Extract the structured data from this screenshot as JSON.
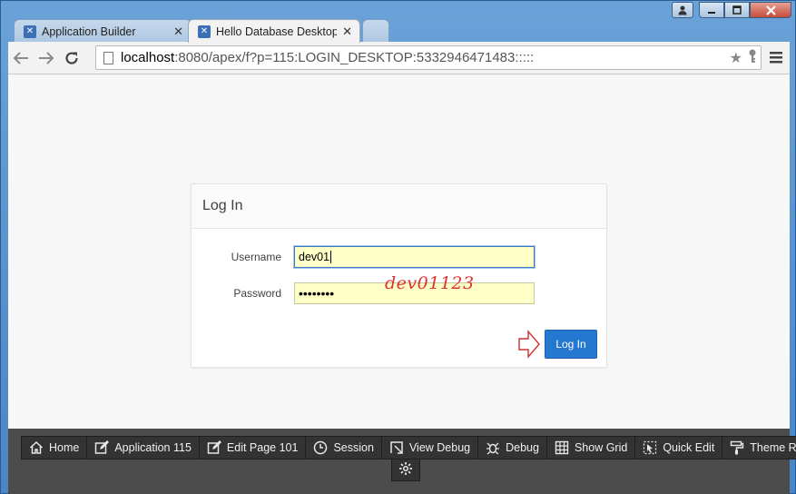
{
  "browser": {
    "tabs": [
      {
        "label": "Application Builder",
        "active": false
      },
      {
        "label": "Hello Database Desktop A",
        "active": true
      }
    ],
    "url_host": "localhost",
    "url_rest": ":8080/apex/f?p=115:LOGIN_DESKTOP:5332946471483:::::"
  },
  "login": {
    "title": "Log In",
    "username_label": "Username",
    "username_value": "dev01",
    "password_label": "Password",
    "password_masked": "••••••••",
    "annotation": "dev01123",
    "login_button": "Log In"
  },
  "devbar": {
    "items": [
      {
        "label": "Home",
        "icon": "home-icon"
      },
      {
        "label": "Application 115",
        "icon": "edit-icon"
      },
      {
        "label": "Edit Page 101",
        "icon": "edit-page-icon"
      },
      {
        "label": "Session",
        "icon": "clock-icon"
      },
      {
        "label": "View Debug",
        "icon": "view-debug-icon"
      },
      {
        "label": "Debug",
        "icon": "bug-icon"
      },
      {
        "label": "Show Grid",
        "icon": "grid-icon"
      },
      {
        "label": "Quick Edit",
        "icon": "quick-edit-icon"
      },
      {
        "label": "Theme Roller",
        "icon": "paint-roller-icon"
      }
    ]
  },
  "colors": {
    "window_frame": "#4a86c4",
    "primary_button": "#2578cf",
    "devbar_bg": "#4c4c4c",
    "annotation_red": "#e03030",
    "autofill_yellow": "#ffffc8"
  }
}
